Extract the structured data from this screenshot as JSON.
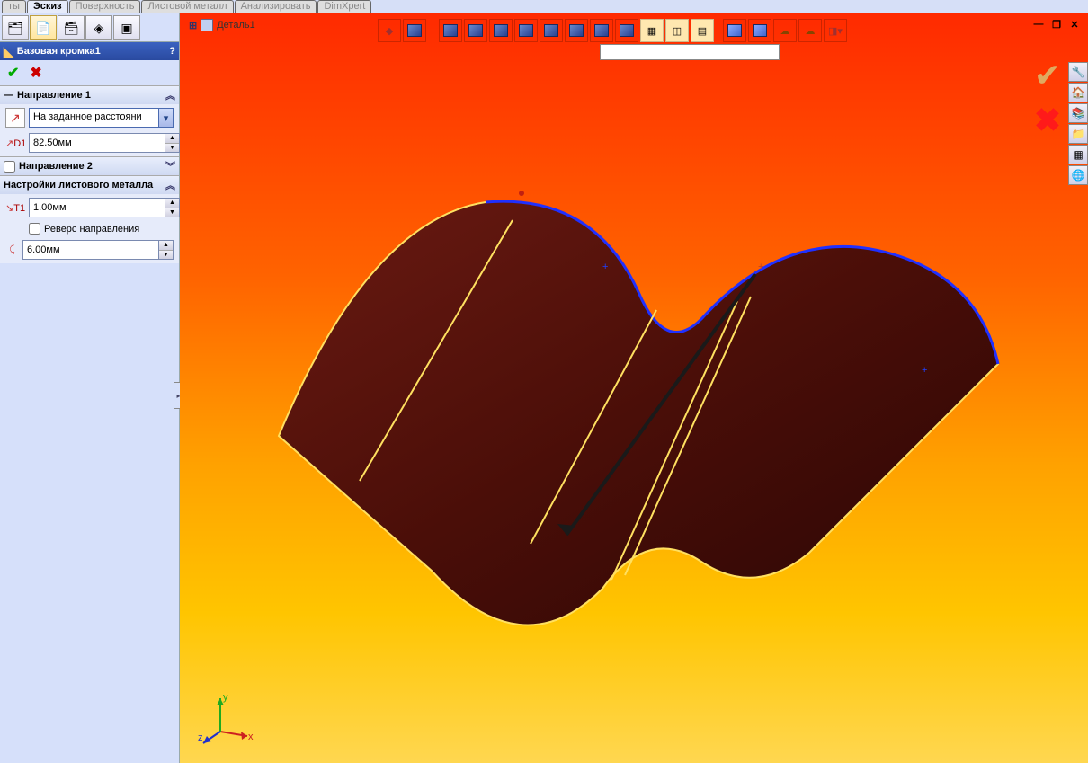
{
  "tabs": [
    "ты",
    "Эскиз",
    "Поверхность",
    "Листовой металл",
    "Анализировать",
    "DimXpert"
  ],
  "active_tab": "Эскиз",
  "feature_title": "Базовая кромка1",
  "breadcrumb": "Деталь1",
  "group1": {
    "title": "Направление 1",
    "end_condition": "На заданное расстояни",
    "d1_label": "D1",
    "d1_value": "82.50мм"
  },
  "group2": {
    "title": "Направление 2"
  },
  "group3": {
    "title": "Настройки листового металла",
    "t1_label": "T1",
    "t1_value": "1.00мм",
    "reverse_label": "Реверс направления",
    "k_label": "",
    "k_value": "6.00мм"
  },
  "axes": {
    "x": "x",
    "y": "y",
    "z": "z"
  },
  "help": "?"
}
